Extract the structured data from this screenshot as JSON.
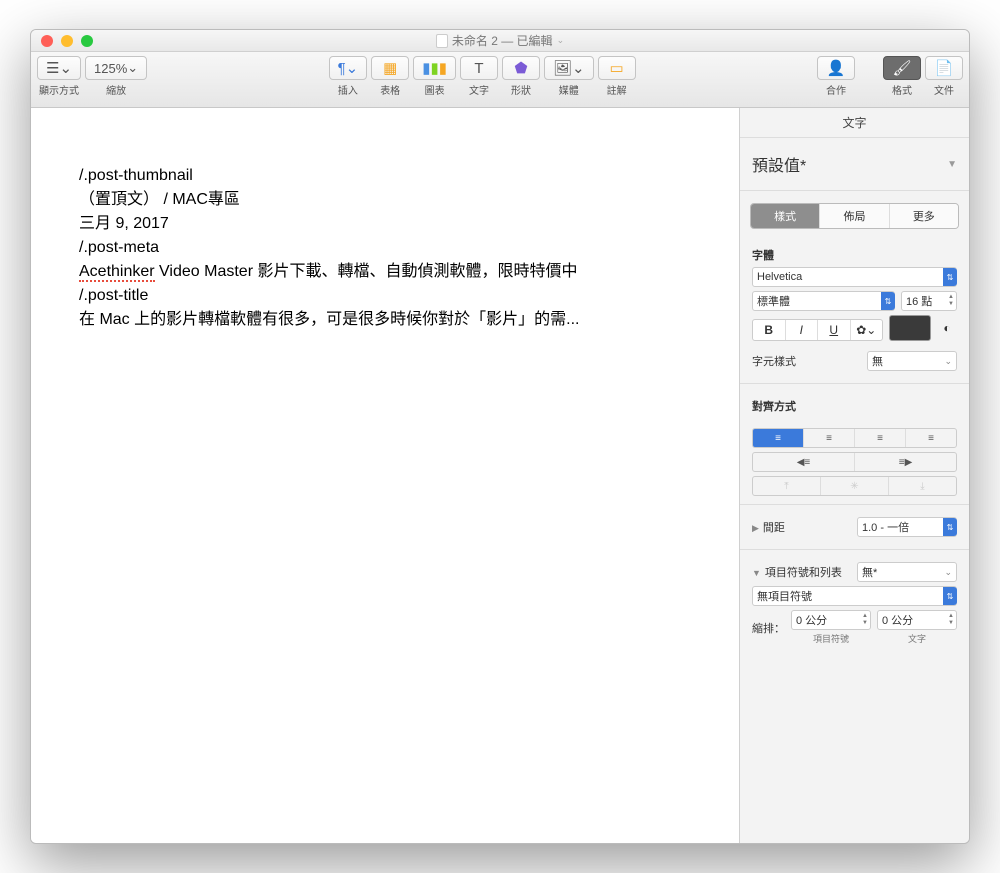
{
  "window": {
    "title": "未命名 2 — 已編輯"
  },
  "toolbar": {
    "view": "顯示方式",
    "zoom": "縮放",
    "zoom_value": "125%",
    "insert": "插入",
    "table": "表格",
    "chart": "圖表",
    "text": "文字",
    "shape": "形狀",
    "media": "媒體",
    "comment": "註解",
    "collab": "合作",
    "format": "格式",
    "document": "文件"
  },
  "doc": {
    "l1": "/.post-thumbnail",
    "l2": "（置頂文） / MAC專區",
    "l3": "三月 9, 2017",
    "l4": "/.post-meta",
    "l5a": "Acethinker",
    "l5b": " Video Master 影片下載、轉檔、自動偵測軟體，限時特價中",
    "l6": "/.post-title",
    "l7": "在 Mac 上的影片轉檔軟體有很多，可是很多時候你對於「影片」的需..."
  },
  "inspector": {
    "tab_text": "文字",
    "style_name": "預設值*",
    "seg_style": "樣式",
    "seg_layout": "佈局",
    "seg_more": "更多",
    "font_header": "字體",
    "font_family": "Helvetica",
    "font_weight": "標準體",
    "font_size": "16 點",
    "char_style_label": "字元樣式",
    "char_style_value": "無",
    "align_header": "對齊方式",
    "spacing_label": "間距",
    "spacing_value": "1.0 - 一倍",
    "bullets_label": "項目符號和列表",
    "bullets_value": "無*",
    "no_bullets": "無項目符號",
    "indent_label": "縮排：",
    "indent_bullet": "0 公分",
    "indent_text": "0 公分",
    "indent_bullet_sub": "項目符號",
    "indent_text_sub": "文字"
  }
}
